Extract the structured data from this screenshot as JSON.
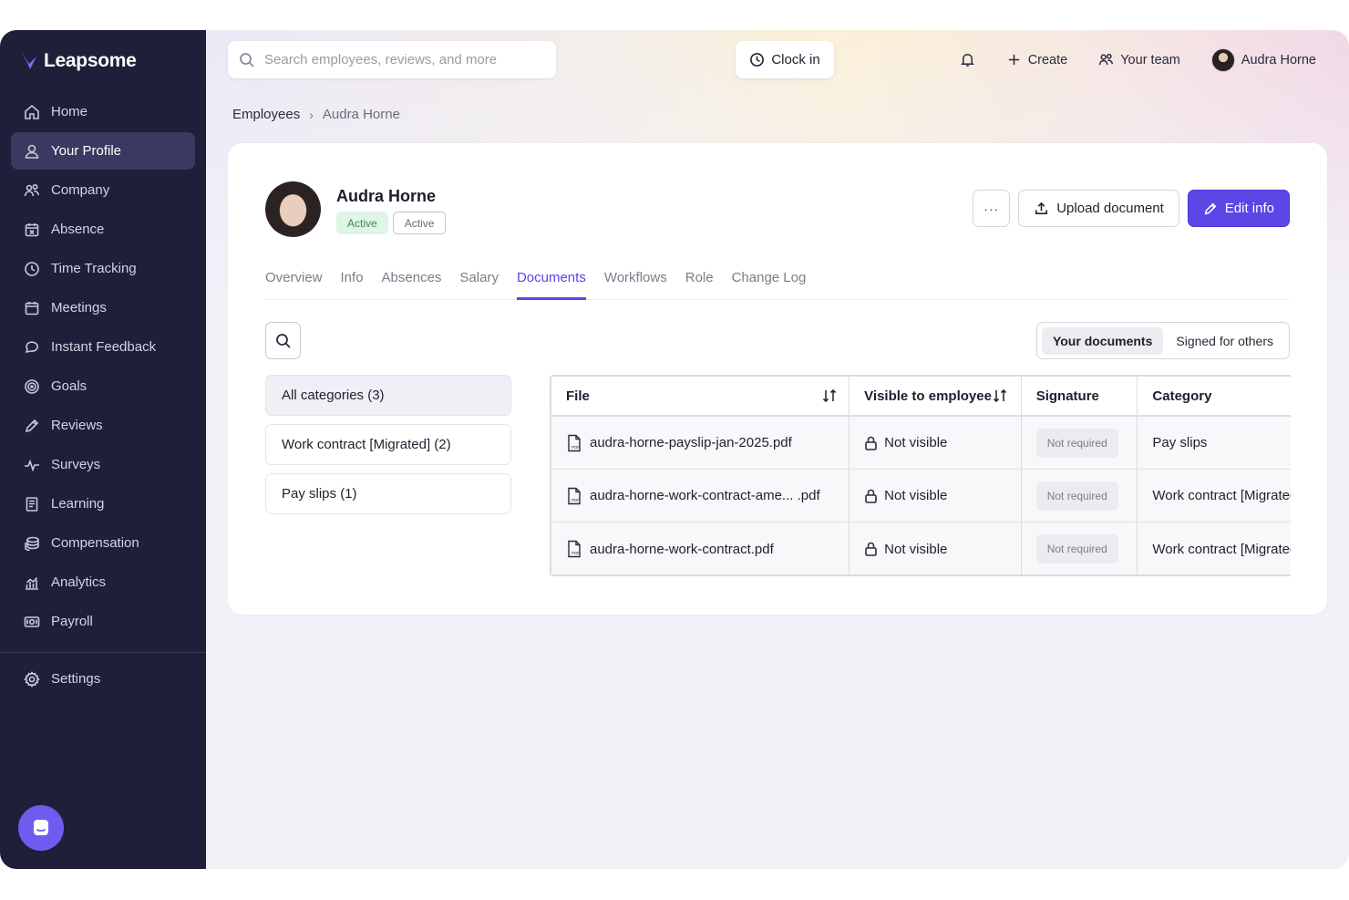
{
  "app": {
    "brand": "Leapsome"
  },
  "sidebar": {
    "items": [
      {
        "label": "Home",
        "icon": "home-icon"
      },
      {
        "label": "Your Profile",
        "icon": "user-icon",
        "active": true
      },
      {
        "label": "Company",
        "icon": "users-icon"
      },
      {
        "label": "Absence",
        "icon": "calendar-x-icon"
      },
      {
        "label": "Time Tracking",
        "icon": "clock-icon"
      },
      {
        "label": "Meetings",
        "icon": "calendar-icon"
      },
      {
        "label": "Instant Feedback",
        "icon": "chat-bubble-icon"
      },
      {
        "label": "Goals",
        "icon": "target-icon"
      },
      {
        "label": "Reviews",
        "icon": "pencil-icon"
      },
      {
        "label": "Surveys",
        "icon": "pulse-icon"
      },
      {
        "label": "Learning",
        "icon": "book-icon"
      },
      {
        "label": "Compensation",
        "icon": "coins-icon"
      },
      {
        "label": "Analytics",
        "icon": "chart-icon"
      },
      {
        "label": "Payroll",
        "icon": "cash-icon"
      }
    ],
    "settings_label": "Settings"
  },
  "topbar": {
    "search_placeholder": "Search employees, reviews, and more",
    "clock_in_label": "Clock in",
    "create_label": "Create",
    "team_label": "Your team",
    "user_name": "Audra Horne"
  },
  "breadcrumb": {
    "parent": "Employees",
    "current": "Audra Horne"
  },
  "profile": {
    "name": "Audra Horne",
    "badge_status": "Active",
    "badge_secondary": "Active",
    "more_label": "···",
    "upload_label": "Upload document",
    "edit_label": "Edit info"
  },
  "tabs": [
    {
      "label": "Overview"
    },
    {
      "label": "Info"
    },
    {
      "label": "Absences"
    },
    {
      "label": "Salary"
    },
    {
      "label": "Documents",
      "active": true
    },
    {
      "label": "Workflows"
    },
    {
      "label": "Role"
    },
    {
      "label": "Change Log"
    }
  ],
  "documents": {
    "segment": {
      "yours": "Your documents",
      "others": "Signed for others"
    },
    "categories": [
      {
        "label": "All categories (3)",
        "active": true
      },
      {
        "label": "Work contract [Migrated] (2)"
      },
      {
        "label": "Pay slips (1)"
      }
    ],
    "table": {
      "headers": {
        "file": "File",
        "visible": "Visible to employee",
        "signature": "Signature",
        "category": "Category"
      },
      "rows": [
        {
          "file": "audra-horne-payslip-jan-2025.pdf",
          "visible": "Not visible",
          "signature": "Not required",
          "category": "Pay slips"
        },
        {
          "file": "audra-horne-work-contract-ame... .pdf",
          "visible": "Not visible",
          "signature": "Not required",
          "category": "Work contract [Migrated]"
        },
        {
          "file": "audra-horne-work-contract.pdf",
          "visible": "Not visible",
          "signature": "Not required",
          "category": "Work contract [Migrated]"
        }
      ]
    }
  },
  "colors": {
    "accent": "#5b46e6",
    "sidebar_bg": "#1f1f3a",
    "active_badge_bg": "#dff5e6"
  }
}
